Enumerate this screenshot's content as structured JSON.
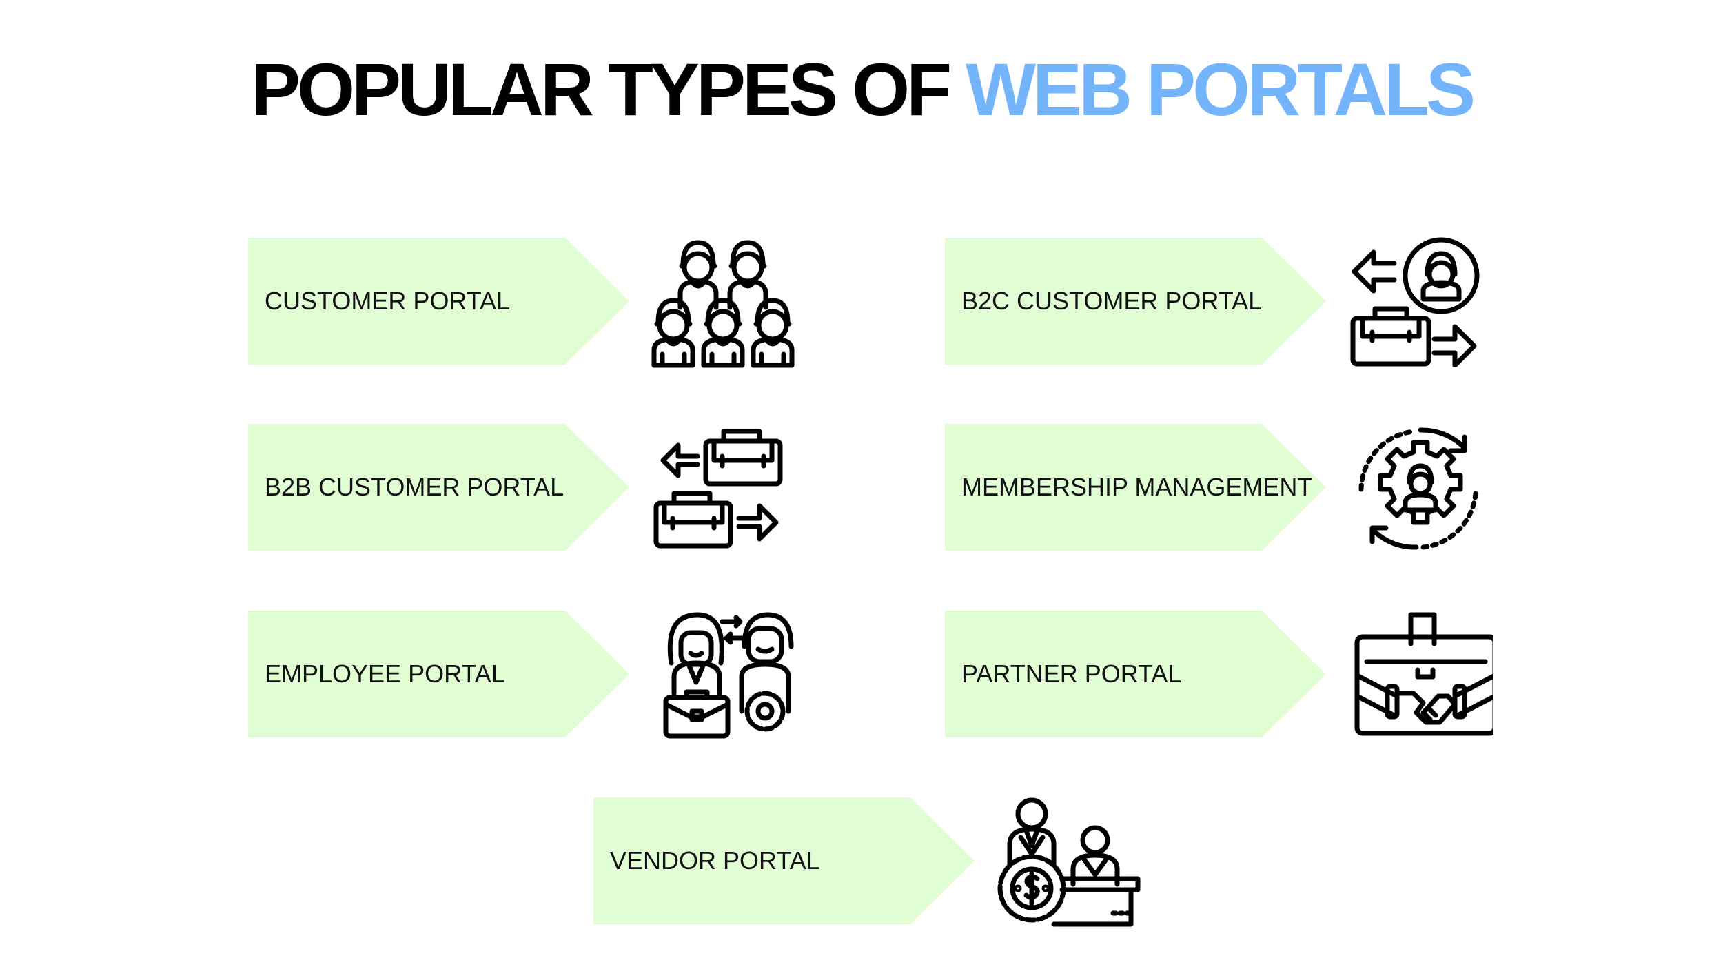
{
  "title": {
    "part1": "POPULAR TYPES OF ",
    "part2": "WEB PORTALS",
    "accent_color": "#74b4fb"
  },
  "colors": {
    "card_fill": "#e1fdd4",
    "icon_stroke": "#000000"
  },
  "portals": [
    {
      "label": "CUSTOMER PORTAL",
      "icon": "group-of-people-icon"
    },
    {
      "label": "B2C CUSTOMER PORTAL",
      "icon": "person-briefcase-exchange-icon"
    },
    {
      "label": "B2B CUSTOMER PORTAL",
      "icon": "briefcase-exchange-icon"
    },
    {
      "label": "MEMBERSHIP MANAGEMENT",
      "icon": "person-gear-cycle-icon"
    },
    {
      "label": "EMPLOYEE PORTAL",
      "icon": "employees-gear-briefcase-icon"
    },
    {
      "label": "PARTNER PORTAL",
      "icon": "briefcase-handshake-icon"
    },
    {
      "label": "VENDOR PORTAL",
      "icon": "vendor-dollar-gear-desk-icon"
    }
  ]
}
